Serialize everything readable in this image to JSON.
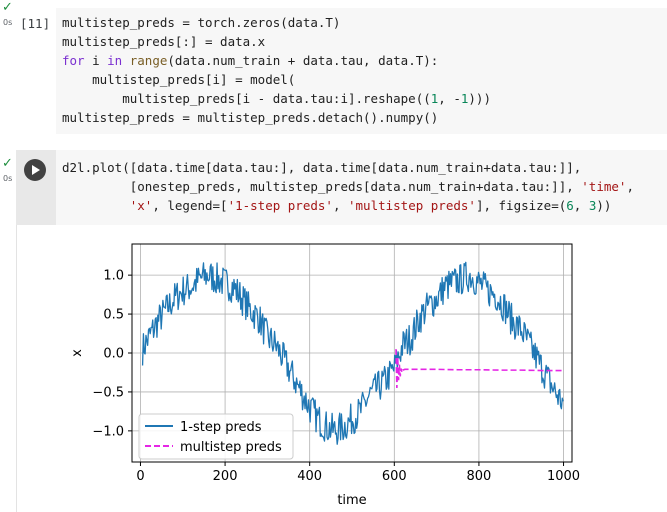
{
  "cell1": {
    "status_icon": "check-icon",
    "runtime": "0s",
    "exec_count": "[11]",
    "lines": [
      "multistep_preds = torch.zeros(data.T)",
      "multistep_preds[:] = data.x",
      "for i in range(data.num_train + data.tau, data.T):",
      "    multistep_preds[i] = model(",
      "        multistep_preds[i - data.tau:i].reshape((1, -1)))",
      "multistep_preds = multistep_preds.detach().numpy()"
    ]
  },
  "cell2": {
    "status_icon": "check-icon",
    "runtime": "0s",
    "run_icon": "play-icon",
    "lines": [
      "d2l.plot([data.time[data.tau:], data.time[data.num_train+data.tau:]],",
      "         [onestep_preds, multistep_preds[data.num_train+data.tau:]], 'time',",
      "         'x', legend=['1-step preds', 'multistep preds'], figsize=(6, 3))"
    ]
  },
  "colors": {
    "series1": "#1f77b4",
    "series2": "#e526e5",
    "check": "#1e8e3e"
  },
  "chart_data": {
    "type": "line",
    "xlabel": "time",
    "ylabel": "x",
    "xlim": [
      -20,
      1020
    ],
    "ylim": [
      -1.4,
      1.4
    ],
    "xticks": [
      0,
      200,
      400,
      600,
      800,
      1000
    ],
    "xtick_labels": [
      "0",
      "200",
      "400",
      "600",
      "800",
      "1000"
    ],
    "yticks": [
      1.0,
      0.5,
      0.0,
      -0.5,
      -1.0
    ],
    "ytick_labels": [
      "1.0",
      "0.5",
      "0.0",
      "−0.5",
      "−1.0"
    ],
    "grid": true,
    "legend_position": "lower-left",
    "legend": [
      "1-step preds",
      "multistep preds"
    ],
    "series": [
      {
        "name": "1-step preds",
        "style": "solid",
        "x": [
          5,
          20,
          40,
          60,
          80,
          100,
          120,
          140,
          160,
          180,
          200,
          220,
          240,
          260,
          280,
          300,
          320,
          340,
          360,
          380,
          400,
          420,
          440,
          460,
          480,
          500,
          520,
          540,
          560,
          580,
          600,
          620,
          640,
          660,
          680,
          700,
          720,
          740,
          760,
          780,
          800,
          820,
          840,
          860,
          880,
          900,
          920,
          940,
          960,
          980,
          1000
        ],
        "y": [
          0.05,
          0.2,
          0.4,
          0.55,
          0.7,
          0.8,
          0.85,
          0.95,
          1.0,
          0.95,
          0.9,
          0.85,
          0.7,
          0.55,
          0.45,
          0.2,
          0.1,
          -0.1,
          -0.3,
          -0.5,
          -0.7,
          -0.85,
          -0.95,
          -1.0,
          -0.95,
          -0.85,
          -0.75,
          -0.55,
          -0.45,
          -0.35,
          -0.2,
          0.1,
          0.2,
          0.45,
          0.6,
          0.7,
          0.85,
          0.9,
          0.95,
          1.0,
          0.9,
          0.8,
          0.75,
          0.6,
          0.4,
          0.3,
          0.1,
          -0.1,
          -0.3,
          -0.5,
          -0.65
        ]
      },
      {
        "name": "multistep preds",
        "style": "dashed",
        "x": [
          604,
          606,
          608,
          610,
          612,
          614,
          616,
          618,
          620,
          625,
          650,
          700,
          750,
          800,
          850,
          900,
          950,
          1000
        ],
        "y": [
          0.05,
          -0.45,
          -0.05,
          -0.35,
          -0.15,
          -0.3,
          -0.2,
          -0.25,
          -0.22,
          -0.21,
          -0.21,
          -0.21,
          -0.215,
          -0.215,
          -0.22,
          -0.22,
          -0.225,
          -0.225
        ]
      }
    ]
  }
}
